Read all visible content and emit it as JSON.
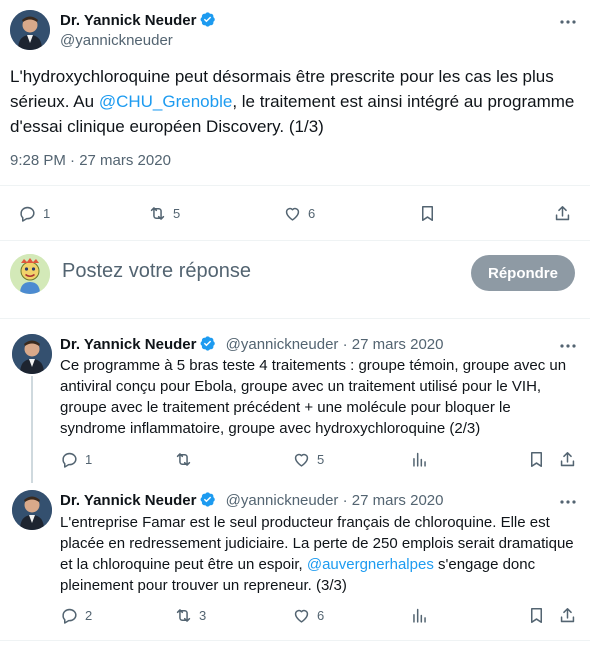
{
  "main_tweet": {
    "display_name": "Dr. Yannick Neuder",
    "handle": "@yannickneuder",
    "text_before": "L'hydroxychloroquine peut désormais être prescrite pour les cas les plus sérieux. Au ",
    "mention": "@CHU_Grenoble",
    "text_after": ", le traitement est ainsi intégré au programme d'essai clinique européen Discovery. (1/3)",
    "timestamp": "9:28 PM · 27 mars 2020",
    "actions": {
      "replies": "1",
      "retweets": "5",
      "likes": "6"
    }
  },
  "reply_box": {
    "placeholder": "Postez votre réponse",
    "button_label": "Répondre"
  },
  "thread": [
    {
      "display_name": "Dr. Yannick Neuder",
      "handle": "@yannickneuder",
      "date": " · 27 mars 2020",
      "text": "Ce programme à 5 bras teste 4 traitements : groupe témoin, groupe avec un antiviral conçu pour Ebola, groupe avec un traitement utilisé pour le VIH, groupe avec le traitement précédent + une molécule pour bloquer le syndrome inflammatoire, groupe avec hydroxychloroquine (2/3)",
      "actions": {
        "replies": "1",
        "retweets": "",
        "likes": "5"
      }
    },
    {
      "display_name": "Dr. Yannick Neuder",
      "handle": "@yannickneuder",
      "date": " · 27 mars 2020",
      "text_before": "L'entreprise Famar est le seul producteur français de chloroquine. Elle est placée en redressement judiciaire. La perte de 250 emplois serait dramatique et la chloroquine peut être un espoir, ",
      "mention": "@auvergnerhalpes",
      "text_after": " s'engage donc pleinement pour trouver un repreneur. (3/3)",
      "actions": {
        "replies": "2",
        "retweets": "3",
        "likes": "6"
      }
    }
  ],
  "colors": {
    "accent": "#1d9bf0",
    "muted": "#536471",
    "verified": "#1d9bf0",
    "button_disabled": "#8e9aa4"
  },
  "icons": [
    "verified-badge-icon",
    "more-icon",
    "reply-icon",
    "retweet-icon",
    "like-icon",
    "bookmark-icon",
    "share-icon",
    "analytics-icon"
  ]
}
